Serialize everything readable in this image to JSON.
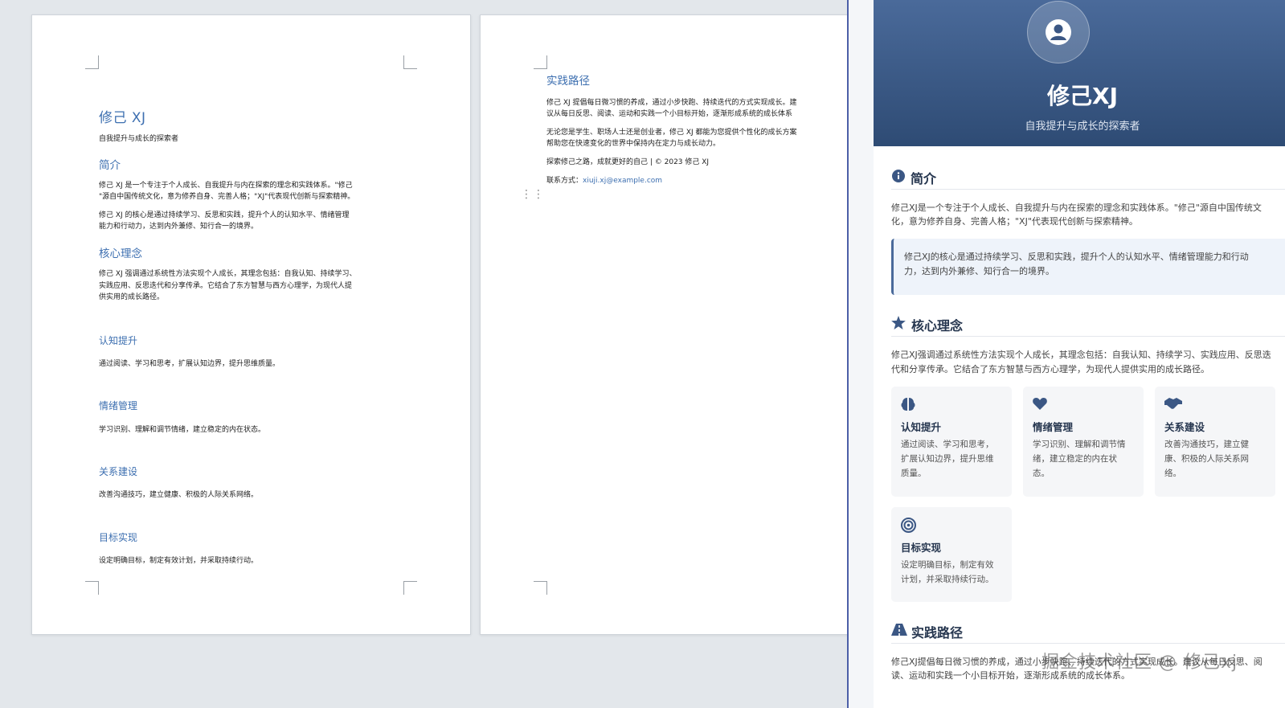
{
  "document": {
    "page1": {
      "title": "修己 XJ",
      "subtitle": "自我提升与成长的探索者",
      "intro_heading": "简介",
      "intro_p1_l1": "修己 XJ 是一个专注于个人成长、自我提升与内在探索的理念和实践体系。\"修己",
      "intro_p1_l2": "\"源自中国传统文化，意为修养自身、完善人格；\"XJ\"代表现代创新与探索精神。",
      "intro_p2_l1": "修己 XJ 的核心是通过持续学习、反思和实践，提升个人的认知水平、情绪管理",
      "intro_p2_l2": "能力和行动力，达到内外兼修、知行合一的境界。",
      "core_heading": "核心理念",
      "core_p_l1": "修己 XJ 强调通过系统性方法实现个人成长，其理念包括：自我认知、持续学习、",
      "core_p_l2": "实践应用、反思迭代和分享传承。它结合了东方智慧与西方心理学，为现代人提",
      "core_p_l3": "供实用的成长路径。",
      "sub1_heading": "认知提升",
      "sub1_text": "通过阅读、学习和思考，扩展认知边界，提升思维质量。",
      "sub2_heading": "情绪管理",
      "sub2_text": "学习识别、理解和调节情绪，建立稳定的内在状态。",
      "sub3_heading": "关系建设",
      "sub3_text": "改善沟通技巧，建立健康、积极的人际关系网络。",
      "sub4_heading": "目标实现",
      "sub4_text": "设定明确目标，制定有效计划，并采取持续行动。"
    },
    "page2": {
      "heading": "实践路径",
      "p1_l1": "修己 XJ 提倡每日微习惯的养成，通过小步快跑、持续迭代的方式实现成长。建",
      "p1_l2": "议从每日反思、阅读、运动和实践一个小目标开始，逐渐形成系统的成长体系",
      "p2_l1": "无论您是学生、职场人士还是创业者，修己 XJ 都能为您提供个性化的成长方案",
      "p2_l2": "帮助您在快速变化的世界中保持内在定力与成长动力。",
      "footer_line": "探索修己之路，成就更好的自己 | © 2023 修己 XJ",
      "contact_label": "联系方式：",
      "contact_email": "xiuji.xj@example.com"
    }
  },
  "preview": {
    "name": "修己XJ",
    "tagline": "自我提升与成长的探索者",
    "intro_title": "简介",
    "intro_l1": "修己XJ是一个专注于个人成长、自我提升与内在探索的理念和实践体系。\"修己\"源自中国传统文",
    "intro_l2": "化，意为修养自身、完善人格；\"XJ\"代表现代创新与探索精神。",
    "quote_l1": "修己XJ的核心是通过持续学习、反思和实践，提升个人的认知水平、情绪管理能力和行动",
    "quote_l2": "力，达到内外兼修、知行合一的境界。",
    "core_title": "核心理念",
    "core_l1": "修己XJ强调通过系统性方法实现个人成长，其理念包括：自我认知、持续学习、实践应用、反思迭",
    "core_l2": "代和分享传承。它结合了东方智慧与西方心理学，为现代人提供实用的成长路径。",
    "tiles": [
      {
        "title": "认知提升",
        "l1": "通过阅读、学习和思考，",
        "l2": "扩展认知边界，提升思维",
        "l3": "质量。",
        "icon": "brain-icon"
      },
      {
        "title": "情绪管理",
        "l1": "学习识别、理解和调节情",
        "l2": "绪，建立稳定的内在状",
        "l3": "态。",
        "icon": "heart-icon"
      },
      {
        "title": "关系建设",
        "l1": "改善沟通技巧，建立健",
        "l2": "康、积极的人际关系网",
        "l3": "络。",
        "icon": "handshake-icon"
      },
      {
        "title": "目标实现",
        "l1": "设定明确目标，制定有效",
        "l2": "计划，并采取持续行动。",
        "l3": "",
        "icon": "target-icon"
      }
    ],
    "practice_title": "实践路径",
    "practice_l1": "修己XJ提倡每日微习惯的养成，通过小步快跑、持续迭代的方式实现成长。建议从每日反思、阅",
    "practice_l2": "读、运动和实践一个小目标开始，逐渐形成系统的成长体系。"
  },
  "watermark": "掘金技术社区 @ 修己xj",
  "colors": {
    "accent": "#3d6fb0",
    "hero_top": "#4a6a9a",
    "hero_bottom": "#2e4b74",
    "heading_dark": "#26364f"
  }
}
